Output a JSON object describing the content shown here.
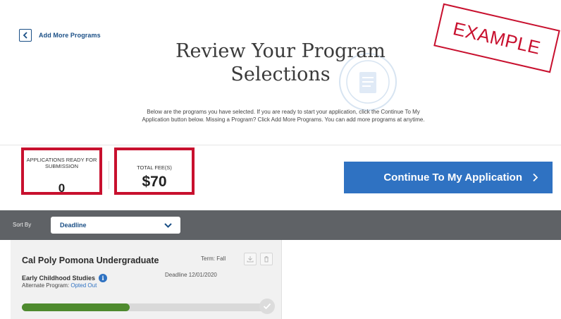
{
  "nav": {
    "back_label": "Add More Programs"
  },
  "header": {
    "title": "Review Your Program Selections",
    "intro": "Below are the programs you have selected. If you are ready to start your application, click the Continue To My Application button below. Missing a Program? Click Add More Programs. You can add more programs at anytime."
  },
  "stamp": {
    "text": "EXAMPLE"
  },
  "stats": {
    "applications_label": "APPLICATIONS READY FOR SUBMISSION",
    "applications_value": "0",
    "fee_label": "TOTAL FEE(S)",
    "fee_value": "$70"
  },
  "actions": {
    "continue_label": "Continue To My Application"
  },
  "sort": {
    "label": "Sort By",
    "selected": "Deadline"
  },
  "programs": [
    {
      "name": "Cal Poly Pomona Undergraduate",
      "term": "Term: Fall",
      "major": "Early Childhood Studies",
      "deadline": "Deadline 12/01/2020",
      "alt_program_label": "Alternate Program:",
      "alt_program_value": "Opted Out",
      "progress": 0.44
    }
  ],
  "colors": {
    "brand_blue": "#2f72c2",
    "link_blue": "#1a4f86",
    "highlight_red": "#c8102e",
    "progress_green": "#4e8a2e",
    "sortbar_gray": "#5f6266"
  },
  "icons": [
    "chevron-left-icon",
    "seal-watermark-icon",
    "chevron-right-icon",
    "chevron-down-icon",
    "download-icon",
    "trash-icon",
    "info-icon",
    "check-icon"
  ]
}
